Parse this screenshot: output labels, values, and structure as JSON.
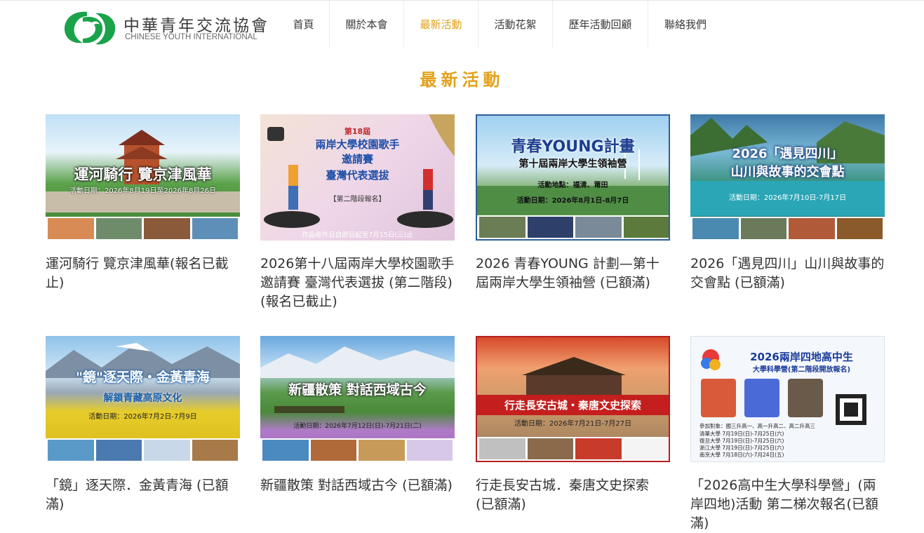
{
  "brand": {
    "name_cn": "中華青年交流協會",
    "name_en": "CHINESE YOUTH INTERNATIONAL",
    "logo_color": "#1aa34a"
  },
  "nav": {
    "items": [
      {
        "label": "首頁",
        "active": false
      },
      {
        "label": "關於本會",
        "active": false
      },
      {
        "label": "最新活動",
        "active": true
      },
      {
        "label": "活動花絮",
        "active": false
      },
      {
        "label": "歷年活動回顧",
        "active": false
      },
      {
        "label": "聯絡我們",
        "active": false
      }
    ],
    "active_color": "#e2a21b"
  },
  "section": {
    "title": "最新活動"
  },
  "cards": [
    {
      "title": "運河騎行 覽京津風華(報名已截止)",
      "banner": "運河騎行 覽京津風華",
      "sub": "活動日期：2026年8月19日至2026年8月26日"
    },
    {
      "title": "2026第十八屆兩岸大學校園歌手邀請賽 臺灣代表選拔 (第二階段)(報名已截止)",
      "banner_top": "第18屆",
      "banner": "兩岸大學校園歌手",
      "banner2": "邀請賽",
      "banner3": "臺灣代表選拔",
      "sub": "【第二階段報名】",
      "sub2": "作品收件日自即日起至7月15日(三)止"
    },
    {
      "title": "2026 青春YOUNG 計劃—第十屆兩岸大學生領袖營 (已額滿)",
      "banner": "青春YOUNG計畫",
      "banner2": "第十屆兩岸大學生領袖營",
      "sub": "活動地點：福清、莆田",
      "sub2": "活動日期：2026年8月1日-8月7日"
    },
    {
      "title": "2026「遇見四川」山川與故事的交會點 (已額滿)",
      "banner": "2026「遇見四川」",
      "banner2": "山川與故事的交會點",
      "sub": "活動日期：2026年7月10日-7月17日"
    },
    {
      "title": "「鏡」逐天際．金黃青海 (已額滿)",
      "banner": "\"鏡\"逐天際・金黃青海",
      "banner2": "解鎖青藏高原文化",
      "sub": "活動日期：2026年7月2日-7月9日"
    },
    {
      "title": "新疆散策 對話西域古今 (已額滿)",
      "banner": "新疆散策 對話西域古今",
      "sub": "活動日期：2026年7月12日(日)-7月21日(二)"
    },
    {
      "title": "行走長安古城．秦唐文史探索 (已額滿)",
      "banner": "行走長安古城・秦唐文史探索",
      "sub": "活動日期：2026年7月21日-7月27日"
    },
    {
      "title": "「2026高中生大學科學營」(兩岸四地)活動 第二梯次報名(已額滿)",
      "banner": "2026兩岸四地高中生",
      "banner2": "大學科學營(第二階段開放報名)",
      "sub": "參加對象：國三升高一、高一升高二、高二升高三",
      "schedule": [
        "清華大學 7月19日(日)-7月25日(六)",
        "復旦大學 7月19日(日)-7月25日(六)",
        "浙江大學 7月19日(日)-7月25日(六)",
        "南京大學 7月18日(六)-7月24日(五)"
      ]
    }
  ]
}
